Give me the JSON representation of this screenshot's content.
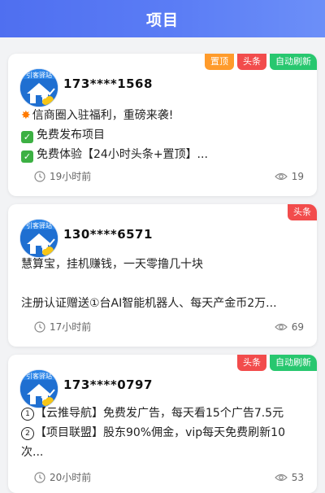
{
  "header": {
    "title": "项目"
  },
  "posts": [
    {
      "tags": [
        "置顶",
        "头条",
        "自动刷新"
      ],
      "phone": "173****1568",
      "lines": [
        "信商圈入驻福利，重磅来袭!",
        "免费发布项目",
        "免费体验【24小时头条+置顶】..."
      ],
      "time": "19小时前",
      "views": "19"
    },
    {
      "tags": [
        "头条"
      ],
      "phone": "130****6571",
      "lines": [
        "慧算宝，挂机赚钱，一天零撸几十块",
        "",
        "注册认证赠送①台AI智能机器人、每天产金币2万..."
      ],
      "time": "17小时前",
      "views": "69"
    },
    {
      "tags": [
        "头条",
        "自动刷新"
      ],
      "phone": "173****0797",
      "lines": [
        "【云推导航】免费发广告，每天看15个广告7.5元",
        "【项目联盟】股东90%佣金，vip每天免费刷新10",
        "次..."
      ],
      "time": "20小时前",
      "views": "53"
    }
  ],
  "avatar_text": "引客驿站",
  "colors": {
    "header": "#5b7df5",
    "tag_top": "#ff9b2b",
    "tag_headline": "#f24c4c",
    "tag_refresh": "#28c76f"
  },
  "icons": {
    "time": "clock-icon",
    "views": "eye-icon"
  }
}
